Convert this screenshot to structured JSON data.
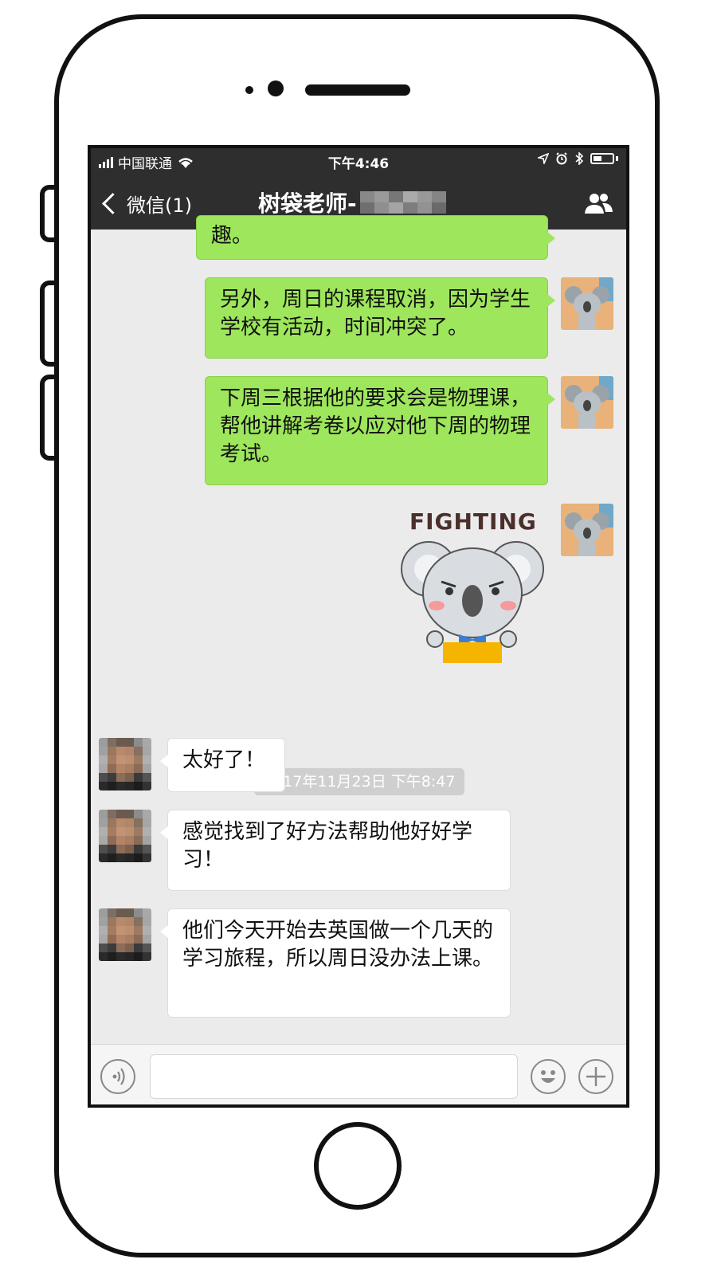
{
  "status_bar": {
    "carrier": "中国联通",
    "time": "下午4:46"
  },
  "nav": {
    "back_label": "微信(1)",
    "title": "树袋老师-"
  },
  "messages": {
    "partial_top": "趣。",
    "sent_1": "另外，周日的课程取消，因为学生学校有活动，时间冲突了。",
    "sent_2": "下周三根据他的要求会是物理课，帮他讲解考卷以应对他下周的物理考试。",
    "sticker_text": "FIGHTING",
    "timestamp": "2017年11月23日 下午8:47",
    "recv_1": "太好了！",
    "recv_2": "感觉找到了好方法帮助他好好学习！",
    "recv_3": "他们今天开始去英国做一个几天的学习旅程，所以周日没办法上课。"
  },
  "icons": {
    "voice": "voice-icon",
    "emoji": "emoji-icon",
    "plus": "plus-icon",
    "contact": "contact-icon"
  },
  "colors": {
    "sent_bubble": "#9ee65c",
    "received_bubble": "#ffffff",
    "navbar": "#2e2e2e",
    "chat_bg": "#ebebeb"
  }
}
